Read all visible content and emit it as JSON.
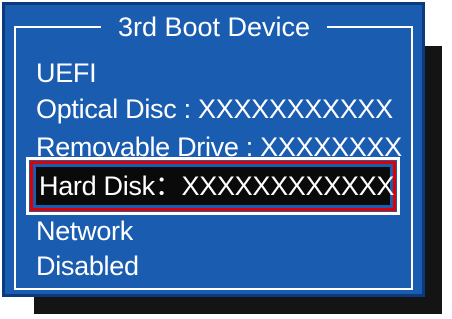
{
  "dialog": {
    "title": "3rd Boot Device",
    "options": [
      "UEFI",
      "Optical Disc : XXXXXXXXXXX",
      "Removable Drive : XXXXXXXX",
      "Hard Disk：XXXXXXXXXXXX",
      "Network",
      "Disabled"
    ],
    "selected_index": 3
  },
  "colors": {
    "dialog_bg": "#1a5cb0",
    "selection_bg": "#0a0a0a",
    "selection_border_red": "#e00000",
    "text": "#ffffff",
    "shadow": "#141414"
  }
}
